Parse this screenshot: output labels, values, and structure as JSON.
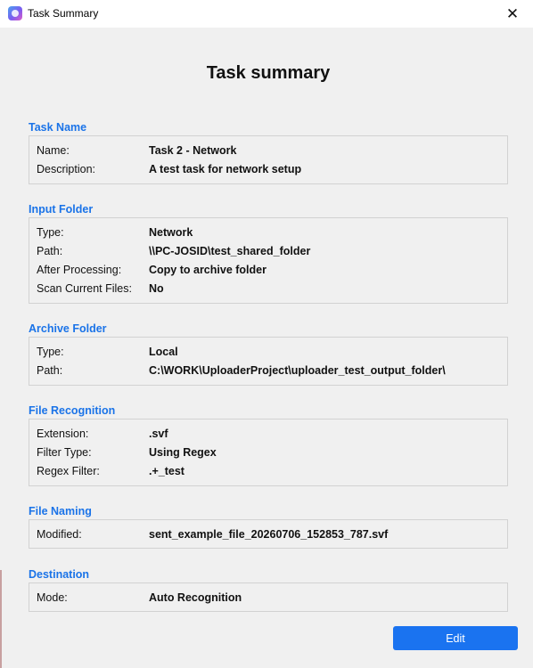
{
  "window": {
    "title": "Task Summary",
    "close_glyph": "✕",
    "app_icon": "app-logo-icon"
  },
  "heading": "Task summary",
  "sections": {
    "task_name": {
      "title": "Task Name",
      "rows": [
        {
          "label": "Name:",
          "value": "Task 2 - Network"
        },
        {
          "label": "Description:",
          "value": "A test task for network setup"
        }
      ]
    },
    "input_folder": {
      "title": "Input Folder",
      "rows": [
        {
          "label": "Type:",
          "value": "Network"
        },
        {
          "label": "Path:",
          "value": "\\\\PC-JOSID\\test_shared_folder"
        },
        {
          "label": "After Processing:",
          "value": "Copy to archive folder"
        },
        {
          "label": "Scan Current Files:",
          "value": "No"
        }
      ]
    },
    "archive_folder": {
      "title": "Archive Folder",
      "rows": [
        {
          "label": "Type:",
          "value": "Local"
        },
        {
          "label": "Path:",
          "value": "C:\\WORK\\UploaderProject\\uploader_test_output_folder\\"
        }
      ]
    },
    "file_recognition": {
      "title": "File Recognition",
      "rows": [
        {
          "label": "Extension:",
          "value": ".svf"
        },
        {
          "label": "Filter Type:",
          "value": "Using Regex"
        },
        {
          "label": "Regex Filter:",
          "value": ".+_test"
        }
      ]
    },
    "file_naming": {
      "title": "File Naming",
      "rows": [
        {
          "label": "Modified:",
          "value": "sent_example_file_20260706_152853_787.svf"
        }
      ]
    },
    "destination": {
      "title": "Destination",
      "rows": [
        {
          "label": "Mode:",
          "value": "Auto Recognition"
        }
      ]
    }
  },
  "buttons": {
    "edit": "Edit"
  },
  "colors": {
    "accent": "#1a73e8",
    "button": "#1a73f0",
    "background": "#f0f0f0"
  }
}
